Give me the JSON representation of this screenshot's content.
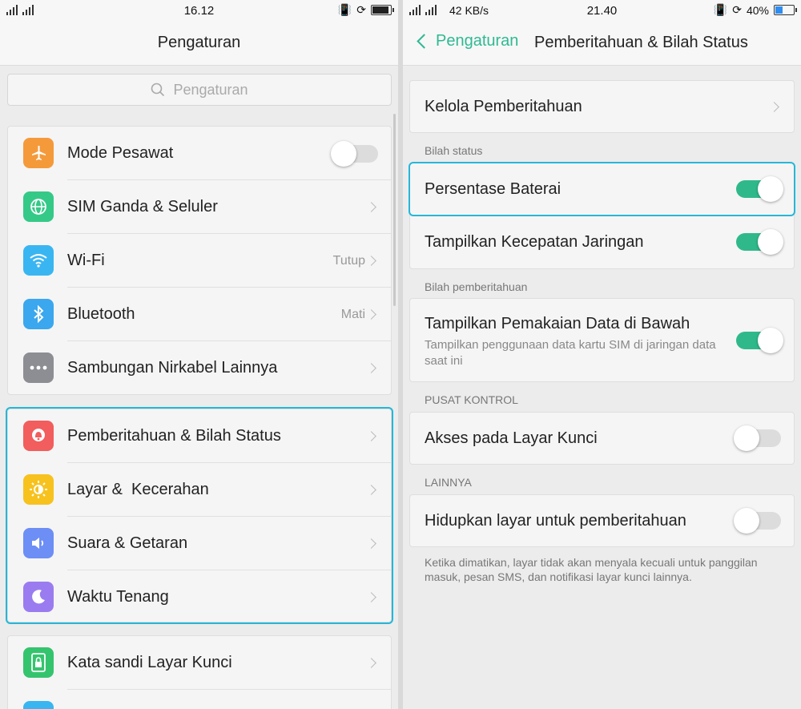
{
  "left": {
    "status": {
      "time": "16.12"
    },
    "title": "Pengaturan",
    "search_placeholder": "Pengaturan",
    "group1": [
      {
        "label": "Mode Pesawat",
        "icon": "airplane-icon",
        "color": "#f59a3b",
        "toggle": false
      },
      {
        "label": "SIM Ganda & Seluler",
        "icon": "globe-icon",
        "color": "#35c987"
      },
      {
        "label": "Wi-Fi",
        "icon": "wifi-icon",
        "color": "#39b6f2",
        "value": "Tutup"
      },
      {
        "label": "Bluetooth",
        "icon": "bluetooth-icon",
        "color": "#3aa7ee",
        "value": "Mati"
      },
      {
        "label": "Sambungan Nirkabel Lainnya",
        "icon": "more-icon",
        "color": "#8d8d94"
      }
    ],
    "group2": [
      {
        "label": "Pemberitahuan & Bilah Status",
        "icon": "notification-icon",
        "color": "#f25d5d"
      },
      {
        "label": "Layar &  Kecerahan",
        "icon": "brightness-icon",
        "color": "#f7c21e"
      },
      {
        "label": "Suara & Getaran",
        "icon": "speaker-icon",
        "color": "#6c8ef5"
      },
      {
        "label": "Waktu Tenang",
        "icon": "moon-icon",
        "color": "#9a7cf0"
      }
    ],
    "group3": [
      {
        "label": "Kata sandi Layar Kunci",
        "icon": "lock-icon",
        "color": "#35c46e"
      }
    ]
  },
  "right": {
    "status": {
      "speed": "42 KB/s",
      "time": "21.40",
      "battery": "40%"
    },
    "back_label": "Pengaturan",
    "title": "Pemberitahuan & Bilah Status",
    "manage": "Kelola Pemberitahuan",
    "section_statusbar": "Bilah status",
    "battery_percent": {
      "label": "Persentase Baterai",
      "on": true
    },
    "network_speed": {
      "label": "Tampilkan Kecepatan Jaringan",
      "on": true
    },
    "section_notifbar": "Bilah pemberitahuan",
    "data_usage": {
      "label": "Tampilkan Pemakaian Data di Bawah",
      "desc": "Tampilkan penggunaan data kartu SIM di jaringan data saat ini",
      "on": true
    },
    "section_control": "PUSAT KONTROL",
    "lockscreen_access": {
      "label": "Akses pada Layar Kunci",
      "on": false
    },
    "section_other": "LAINNYA",
    "wake_screen": {
      "label": "Hidupkan layar untuk pemberitahuan",
      "on": false
    },
    "footnote": "Ketika dimatikan, layar tidak akan menyala kecuali untuk panggilan masuk, pesan SMS, dan notifikasi layar kunci lainnya."
  }
}
